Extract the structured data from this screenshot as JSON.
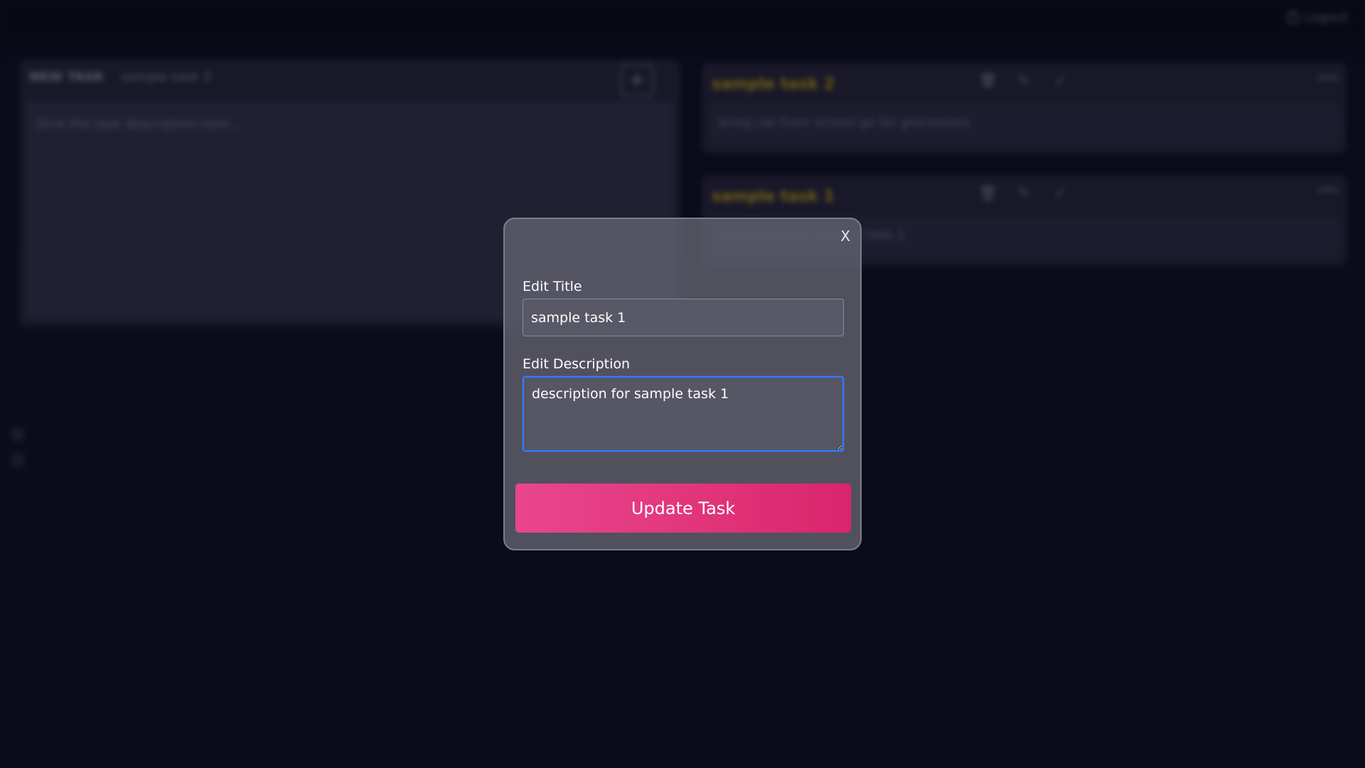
{
  "header": {
    "logout_label": "Logout"
  },
  "new_task": {
    "label": "NEW TASK",
    "title_value": "sample task 3",
    "add_symbol": "+",
    "description_placeholder": "Give the task description here..."
  },
  "tasks": [
    {
      "title": "sample task 2",
      "description": "bring cat from school go for grocessory"
    },
    {
      "title": "sample task 1",
      "description": "description for sample task 1"
    }
  ],
  "modal": {
    "close_label": "X",
    "title_label": "Edit Title",
    "title_value": "sample task 1",
    "description_label": "Edit Description",
    "description_value": "description for sample task 1",
    "submit_label": "Update Task"
  },
  "colors": {
    "accent": "#e23579",
    "task_title": "#c8a21a",
    "focus_border": "#2f7bff"
  },
  "icons": {
    "task_actions": [
      "trash-icon",
      "edit-icon",
      "check-icon"
    ],
    "logout": "power-icon"
  }
}
